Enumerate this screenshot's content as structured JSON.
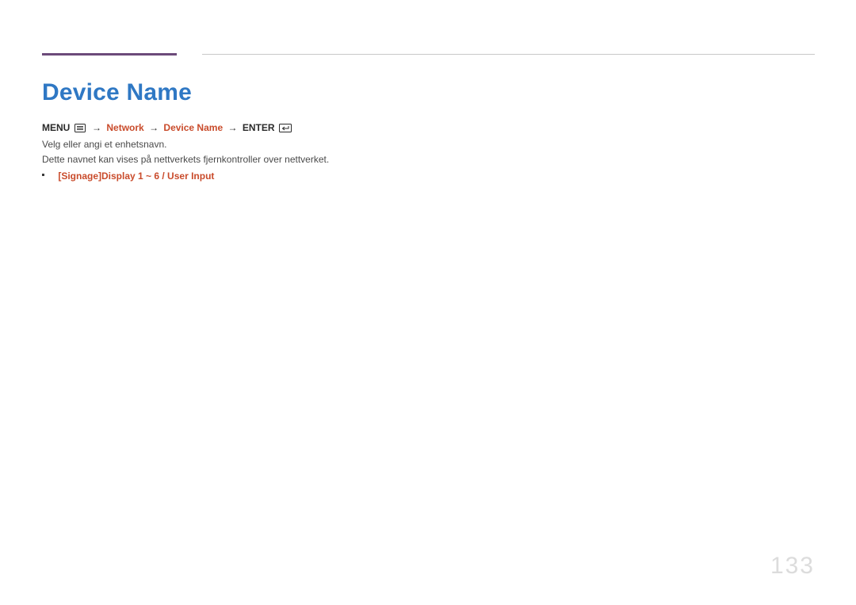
{
  "title": "Device Name",
  "nav": {
    "menu": "MENU",
    "arrow": "→",
    "network": "Network",
    "deviceName": "Device Name",
    "enter": "ENTER"
  },
  "body": {
    "p1": "Velg eller angi et enhetsnavn.",
    "p2": "Dette navnet kan vises på nettverkets fjernkontroller over nettverket."
  },
  "bullet": {
    "text": "[Signage]Display 1 ~ 6 / User Input"
  },
  "pageNumber": "133"
}
